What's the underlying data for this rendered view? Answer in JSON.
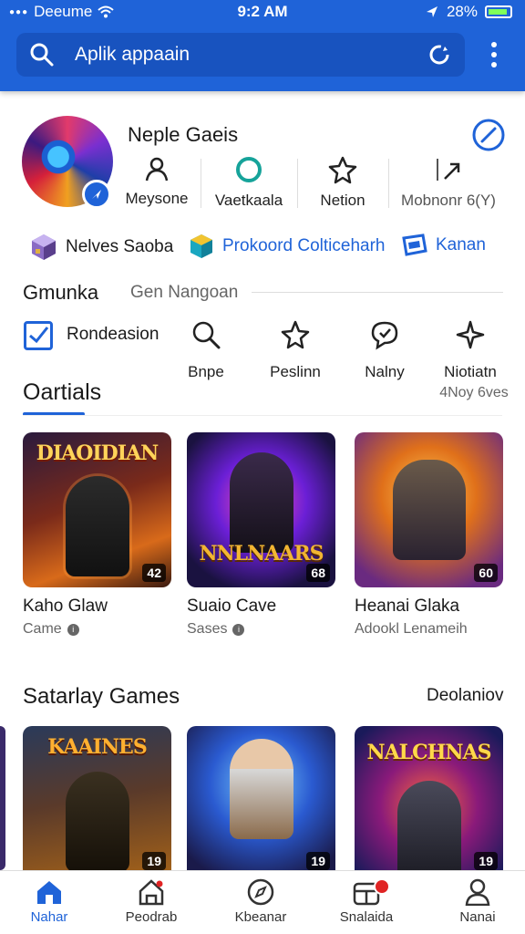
{
  "status_bar": {
    "carrier": "Deeume",
    "time": "9:2 AM",
    "battery": "28%"
  },
  "search": {
    "placeholder": "Aplik appaain"
  },
  "profile": {
    "name": "Neple Gaeis",
    "stats": [
      {
        "label": "Meysone",
        "icon": "person-icon"
      },
      {
        "label": "Vaetkaala",
        "icon": "ring-icon"
      },
      {
        "label": "Netion",
        "icon": "star-icon"
      },
      {
        "label": "Mobnonr 6(Y)",
        "icon": "share-icon"
      }
    ]
  },
  "chips": [
    {
      "label": "Nelves Saoba",
      "icon": "cube-icon"
    },
    {
      "label": "Prokoord Colticeharh",
      "icon": "box-icon"
    },
    {
      "label": "Kanan",
      "icon": "stack-icon"
    }
  ],
  "section1": {
    "title": "Gmunka",
    "subtitle": "Gen Nangoan"
  },
  "filter": {
    "checkbox_label": "Rondeasion"
  },
  "categories": [
    {
      "label": "Bnpe",
      "icon": "search-icon"
    },
    {
      "label": "Peslinn",
      "icon": "star-icon"
    },
    {
      "label": "Nalny",
      "icon": "chat-icon"
    },
    {
      "label": "Niotiatn",
      "icon": "sparkle-icon",
      "sub": "4Noy 6ves"
    }
  ],
  "section2": {
    "title": "Oartials"
  },
  "games": [
    {
      "art_title": "DIAOIDIAN",
      "number": "42",
      "title": "Kaho Glaw",
      "sub": "Came"
    },
    {
      "art_title": "NNLNAARS",
      "number": "68",
      "title": "Suaio Cave",
      "sub": "Sases"
    },
    {
      "art_title": "",
      "number": "60",
      "title": "Heanai Glaka",
      "sub": "Adookl Lenameih"
    }
  ],
  "section3": {
    "title": "Satarlay Games",
    "action": "Deolaniov"
  },
  "games2": [
    {
      "art_title": "KAAINES",
      "number": "19"
    },
    {
      "art_title": "",
      "number": "19"
    },
    {
      "art_title": "NALCHNAS",
      "number": "19"
    }
  ],
  "bottom_nav": [
    {
      "label": "Nahar",
      "icon": "home-icon",
      "active": true
    },
    {
      "label": "Peodrab",
      "icon": "house-outline-icon"
    },
    {
      "label": "Kbeanar",
      "icon": "compass-icon"
    },
    {
      "label": "Snalaida",
      "icon": "store-icon",
      "badge": true
    },
    {
      "label": "Nanai",
      "icon": "user-icon"
    }
  ],
  "colors": {
    "primary": "#1f63d8",
    "header_dark": "#1853bf",
    "teal": "#16a39a",
    "badge_red": "#e02424"
  }
}
